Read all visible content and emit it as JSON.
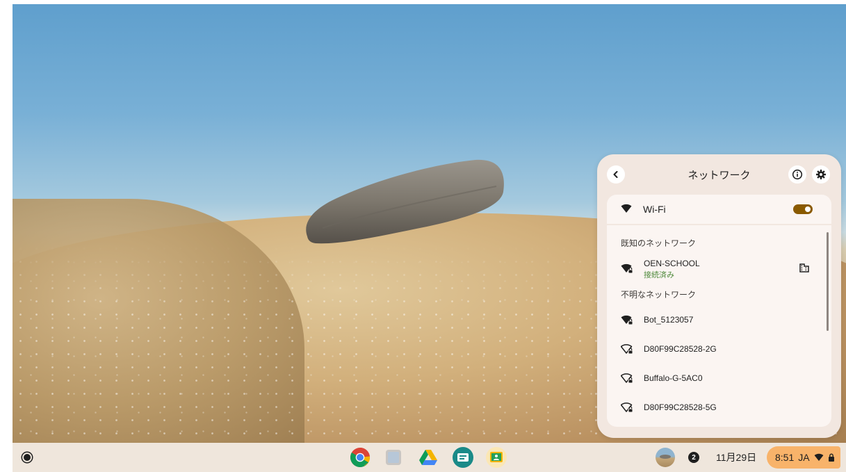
{
  "network_panel": {
    "title": "ネットワーク",
    "back_icon": "chevron-left-icon",
    "info_icon": "info-icon",
    "settings_icon": "gear-icon",
    "wifi": {
      "label": "Wi-Fi",
      "enabled": true
    },
    "known_networks_header": "既知のネットワーク",
    "known_networks": [
      {
        "name": "OEN-SCHOOL",
        "status": "接続済み",
        "icon": "wifi-secure-filled-icon",
        "managed_icon": "building-icon"
      }
    ],
    "unknown_networks_header": "不明なネットワーク",
    "unknown_networks": [
      {
        "name": "Bot_5123057",
        "icon": "wifi-secure-filled-icon"
      },
      {
        "name": "D80F99C28528-2G",
        "icon": "wifi-secure-outline-icon"
      },
      {
        "name": "Buffalo-G-5AC0",
        "icon": "wifi-secure-outline-icon"
      },
      {
        "name": "D80F99C28528-5G",
        "icon": "wifi-secure-outline-icon"
      }
    ]
  },
  "shelf": {
    "launcher_icon": "launcher-icon",
    "apps": [
      "chrome-icon",
      "files-icon",
      "drive-icon",
      "meet-icon",
      "classroom-icon"
    ],
    "notification_count": "2",
    "date": "11月29日",
    "time": "8:51",
    "ime": "JA"
  },
  "colors": {
    "panel_bg": "#f2e7e0",
    "toggle_on": "#8a5a00",
    "connected_text": "#4f8a3c",
    "status_area_bg": "#f8b36a"
  }
}
